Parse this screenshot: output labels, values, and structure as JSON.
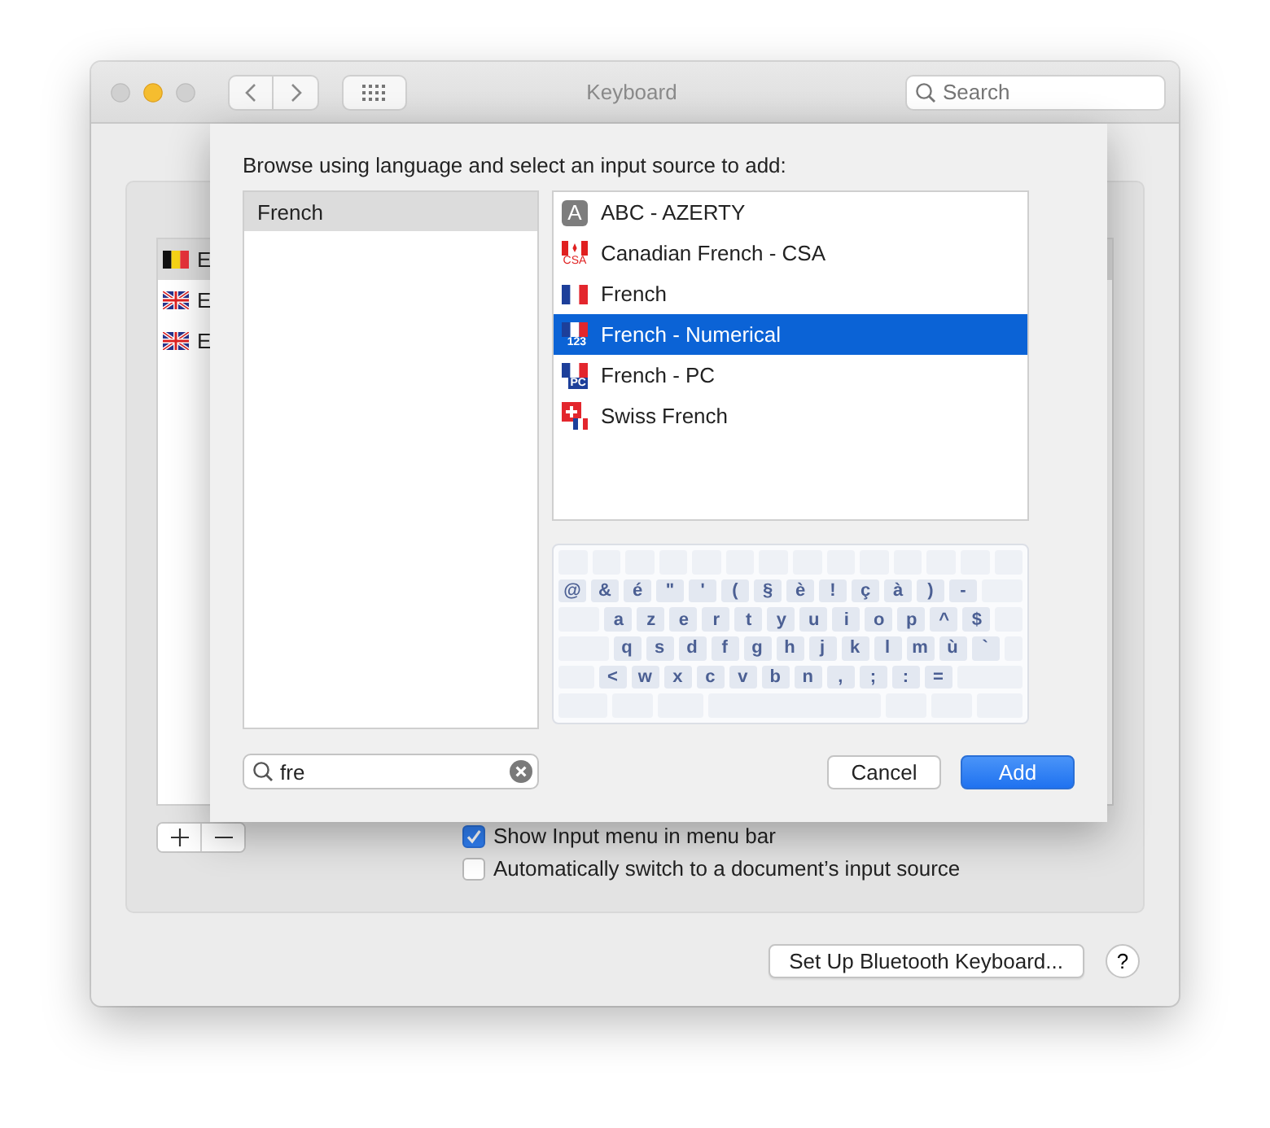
{
  "window": {
    "title": "Keyboard",
    "search": {
      "placeholder": "Search"
    }
  },
  "input_sources": [
    {
      "label": "E",
      "kind": "belgium",
      "selected": true
    },
    {
      "label": "E",
      "kind": "uk",
      "selected": false
    },
    {
      "label": "E",
      "kind": "uk",
      "selected": false
    }
  ],
  "options": [
    {
      "label": "Show Input menu in menu bar",
      "checked": true
    },
    {
      "label": "Automatically switch to a document’s input source",
      "checked": false
    }
  ],
  "bluetooth_button": "Set Up Bluetooth Keyboard...",
  "help_button": "?",
  "sheet": {
    "heading": "Browse using language and select an input source to add:",
    "languages": [
      {
        "label": "French",
        "selected": true
      }
    ],
    "sources": [
      {
        "label": "ABC - AZERTY",
        "kind": "letter",
        "icon_text": "A",
        "selected": false
      },
      {
        "label": "Canadian French - CSA",
        "kind": "canada",
        "icon_text": "CSA",
        "selected": false
      },
      {
        "label": "French",
        "kind": "france",
        "selected": false
      },
      {
        "label": "French - Numerical",
        "kind": "france",
        "icon_text": "123",
        "selected": true
      },
      {
        "label": "French - PC",
        "kind": "france",
        "icon_text": "PC",
        "selected": false
      },
      {
        "label": "Swiss French",
        "kind": "swiss",
        "selected": false
      }
    ],
    "keyboard_rows": [
      [
        "@",
        "&",
        "é",
        "\"",
        "'",
        "(",
        "§",
        "è",
        "!",
        "ç",
        "à",
        ")",
        "-"
      ],
      [
        "a",
        "z",
        "e",
        "r",
        "t",
        "y",
        "u",
        "i",
        "o",
        "p",
        "^",
        "$"
      ],
      [
        "q",
        "s",
        "d",
        "f",
        "g",
        "h",
        "j",
        "k",
        "l",
        "m",
        "ù",
        "`"
      ],
      [
        "<",
        "w",
        "x",
        "c",
        "v",
        "b",
        "n",
        ",",
        ";",
        ":",
        "="
      ]
    ],
    "search": {
      "value": "fre"
    },
    "buttons": [
      {
        "label": "Cancel",
        "kind": "secondary"
      },
      {
        "label": "Add",
        "kind": "primary"
      }
    ]
  }
}
